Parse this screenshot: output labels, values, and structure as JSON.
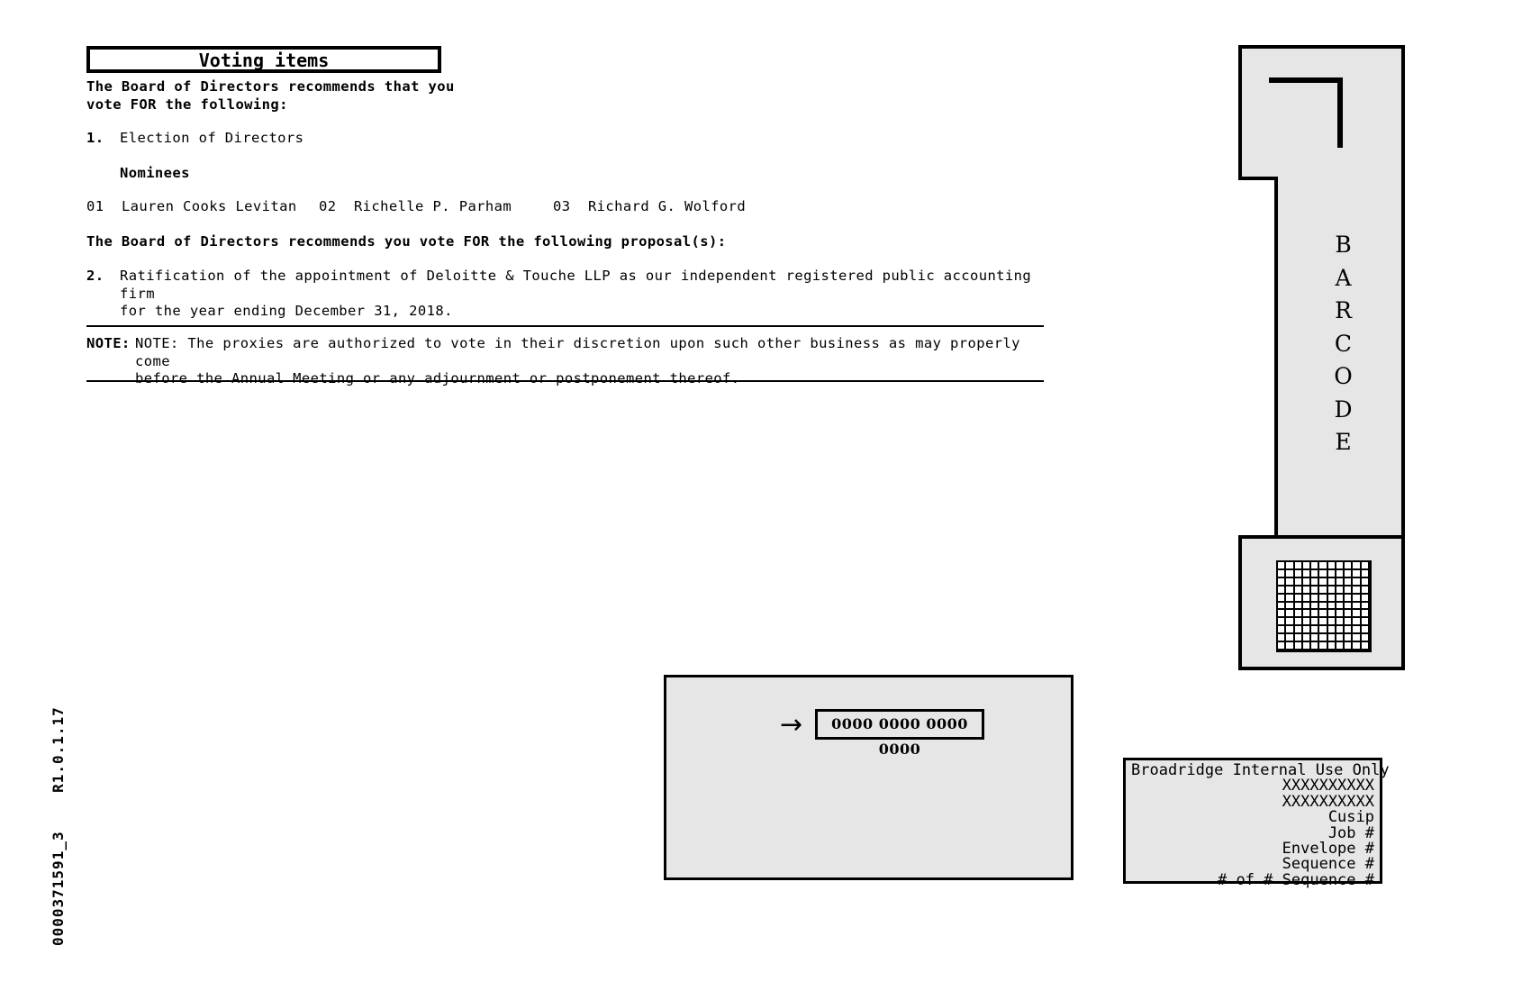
{
  "document": {
    "header_title": "Voting items",
    "recommendation_intro": "The Board of Directors recommends that you\nvote FOR the following:",
    "item1": {
      "number": "1.",
      "text": "Election of Directors",
      "nominees_label": "Nominees",
      "nominees": [
        {
          "num": "01",
          "name": "Lauren Cooks Levitan"
        },
        {
          "num": "02",
          "name": "Richelle P. Parham"
        },
        {
          "num": "03",
          "name": "Richard G. Wolford"
        }
      ]
    },
    "recommendation_proposals": "The Board of Directors recommends you vote FOR the following proposal(s):",
    "item2": {
      "number": "2.",
      "text": "Ratification of the appointment of Deloitte & Touche LLP as our independent registered public accounting firm\nfor the year ending December 31, 2018."
    },
    "note": {
      "label": "NOTE:",
      "text": "NOTE: The proxies are authorized to vote in their discretion upon such other business as may properly come\nbefore the Annual Meeting or any adjournment or postponement thereof."
    },
    "doc_id_vertical": "0000371591_3    R1.0.1.17"
  },
  "barcode_panel": {
    "vertical_label": "BARCODE",
    "vertical_letters": [
      "B",
      "A",
      "R",
      "C",
      "O",
      "D",
      "E"
    ]
  },
  "control_panel": {
    "arrow_icon": "→",
    "control_number": "0000 0000 0000 0000"
  },
  "broadridge": {
    "title": "Broadridge Internal Use Only",
    "lines": [
      "XXXXXXXXXX",
      "XXXXXXXXXX",
      "Cusip",
      "Job #",
      "Envelope #",
      "Sequence #",
      "# of # Sequence #"
    ]
  },
  "colors": {
    "panel_fill": "#e6e6e6",
    "ink": "#000000",
    "page": "#ffffff"
  }
}
